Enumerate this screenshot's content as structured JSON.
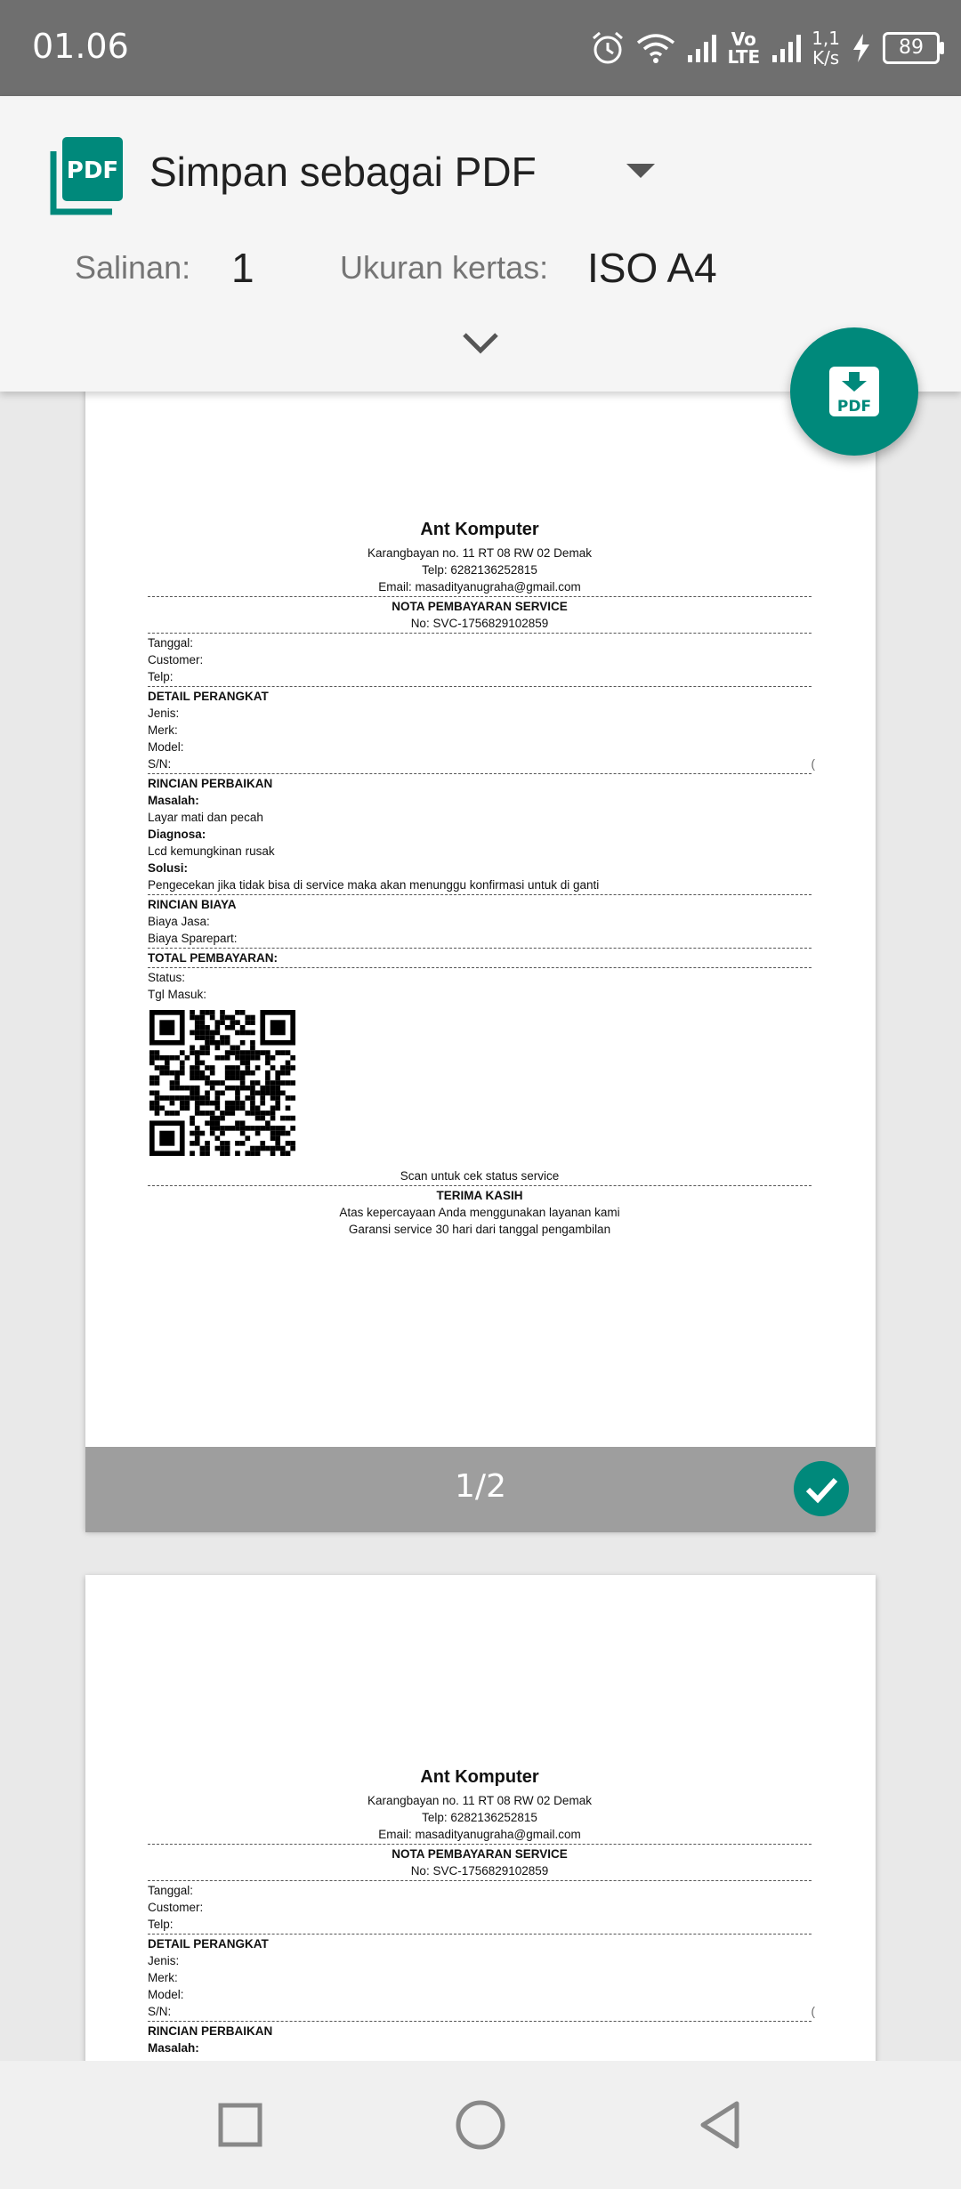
{
  "status_bar": {
    "time": "01.06",
    "volte": "Vo\nLTE",
    "speed_top": "1,1",
    "speed_bottom": "K/s",
    "battery": "89"
  },
  "print_header": {
    "printer_name": "Simpan sebagai PDF",
    "copies_label": "Salinan:",
    "copies_value": "1",
    "paper_label": "Ukuran kertas:",
    "paper_value": "ISO A4",
    "pdf_logo_text": "PDF",
    "fab_icon": "pdf-download-icon"
  },
  "receipt": {
    "shop_name": "Ant Komputer",
    "address": "Karangbayan no. 11 RT 08 RW 02 Demak",
    "phone": "Telp: 6282136252815",
    "email": "Email: masadityanugraha@gmail.com",
    "doc_title": "NOTA PEMBAYARAN SERVICE",
    "doc_number": "No: SVC-1756829102859",
    "field_tanggal": "Tanggal:",
    "field_customer": "Customer:",
    "field_telp": "Telp:",
    "section_device": "DETAIL PERANGKAT",
    "field_jenis": "Jenis:",
    "field_merk": "Merk:",
    "field_model": "Model:",
    "field_sn": "S/N:",
    "sn_value_clipped": "(",
    "section_repair": "RINCIAN PERBAIKAN",
    "label_masalah": "Masalah:",
    "masalah": "Layar mati dan pecah",
    "label_diagnosa": "Diagnosa:",
    "diagnosa": "Lcd kemungkinan rusak",
    "label_solusi": "Solusi:",
    "solusi": "Pengecekan jika tidak bisa di service maka akan menunggu konfirmasi untuk di ganti",
    "section_cost": "RINCIAN BIAYA",
    "field_biaya_jasa": "Biaya Jasa:",
    "field_biaya_sparepart": "Biaya Sparepart:",
    "total": "TOTAL PEMBAYARAN:",
    "field_status": "Status:",
    "field_tgl_masuk": "Tgl Masuk:",
    "scan_text": "Scan untuk cek status service",
    "thanks": "TERIMA KASIH",
    "thanks_line1": "Atas kepercayaan Anda menggunakan layanan kami",
    "thanks_line2": "Garansi service 30 hari dari tanggal pengambilan"
  },
  "page_indicator": "1/2",
  "colors": {
    "accent": "#00897b",
    "status_bar": "#6f6f6f",
    "footer": "#9e9e9e"
  }
}
